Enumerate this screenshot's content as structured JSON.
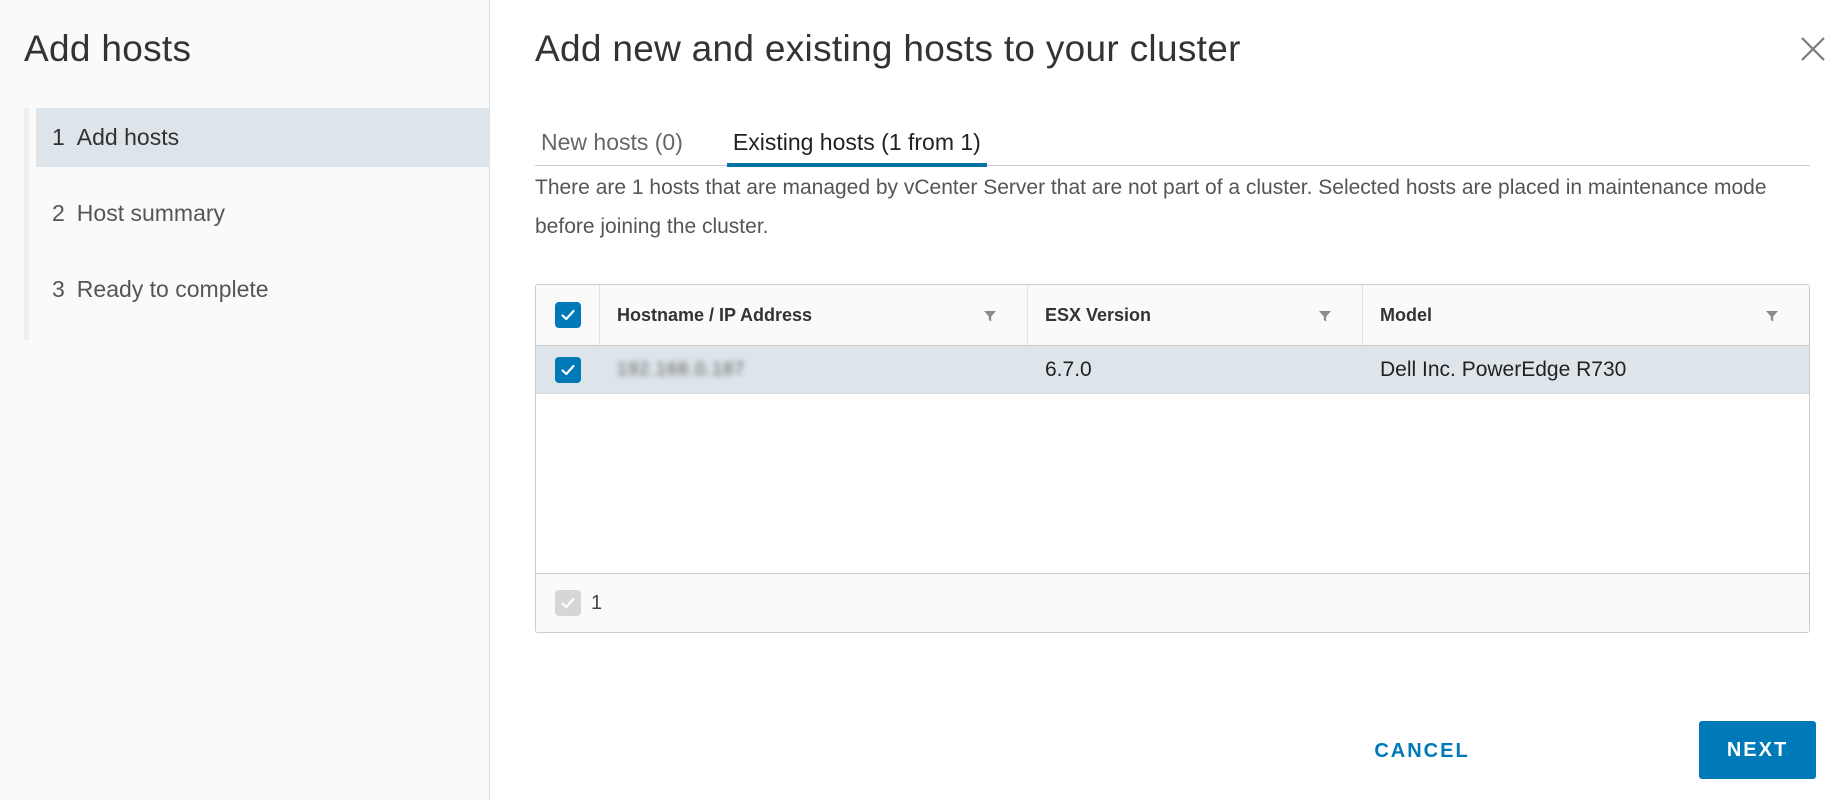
{
  "sidebar": {
    "title": "Add hosts",
    "steps": [
      {
        "number": "1",
        "label": "Add hosts",
        "active": true
      },
      {
        "number": "2",
        "label": "Host summary",
        "active": false
      },
      {
        "number": "3",
        "label": "Ready to complete",
        "active": false
      }
    ]
  },
  "main": {
    "title": "Add new and existing hosts to your cluster",
    "tabs": [
      {
        "label": "New hosts (0)",
        "active": false
      },
      {
        "label": "Existing hosts (1 from 1)",
        "active": true
      }
    ],
    "description": "There are 1 hosts that are managed by vCenter Server that are not part of a cluster. Selected hosts are placed in maintenance mode before joining the cluster."
  },
  "table": {
    "columns": [
      "Hostname / IP Address",
      "ESX Version",
      "Model"
    ],
    "rows": [
      {
        "hostname": "192.168.0.187",
        "esx_version": "6.7.0",
        "model": "Dell Inc. PowerEdge R730",
        "selected": true
      }
    ],
    "footer_count": "1"
  },
  "actions": {
    "cancel_label": "CANCEL",
    "next_label": "NEXT"
  },
  "colors": {
    "accent": "#0079b8",
    "selected_row": "#dde5ea"
  }
}
